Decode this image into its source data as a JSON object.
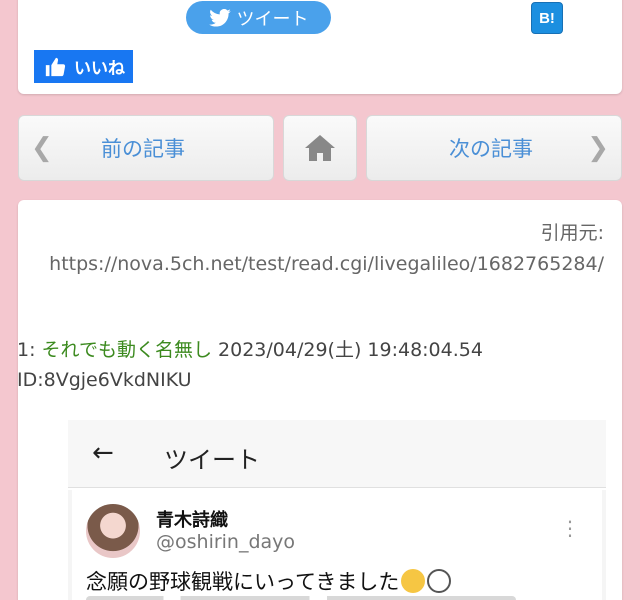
{
  "share": {
    "tweet_label": "ツイート",
    "hatena_label": "B!",
    "like_label": "いいね"
  },
  "nav": {
    "prev_label": "前の記事",
    "next_label": "次の記事"
  },
  "article": {
    "source_label": "引用元:",
    "source_url": "https://nova.5ch.net/test/read.cgi/livegalileo/1682765284/",
    "post": {
      "number": "1:",
      "name": "それでも動く名無し",
      "datetime": "2023/04/29(土) 19:48:04.54",
      "id": "ID:8Vgje6VkdNIKU"
    }
  },
  "tweet_image": {
    "header_title": "ツイート",
    "user_name": "青木詩織",
    "user_handle": "@oshirin_dayo",
    "text": "念願の野球観戦にいってきました"
  },
  "colors": {
    "background": "#f4c7cf",
    "twitter_blue": "#4aa1eb",
    "hatena_blue": "#1c8fe0",
    "facebook_blue": "#1877f2",
    "link_blue": "#4a8fd6",
    "post_name_green": "#3c8a1f"
  }
}
